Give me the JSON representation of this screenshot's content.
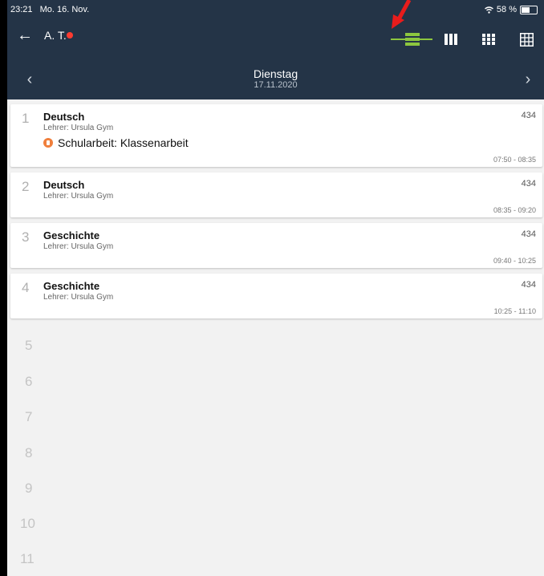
{
  "status": {
    "time": "23:21",
    "date": "Mo. 16. Nov.",
    "battery": "58 %",
    "battery_level": 0.58
  },
  "header": {
    "user": "A. T."
  },
  "date_nav": {
    "day": "Dienstag",
    "date": "17.11.2020"
  },
  "lessons": [
    {
      "num": "1",
      "subject": "Deutsch",
      "teacher": "Lehrer: Ursula Gym",
      "room": "434",
      "time": "07:50 - 08:35",
      "exam": "Schularbeit: Klassenarbeit"
    },
    {
      "num": "2",
      "subject": "Deutsch",
      "teacher": "Lehrer: Ursula Gym",
      "room": "434",
      "time": "08:35 - 09:20"
    },
    {
      "num": "3",
      "subject": "Geschichte",
      "teacher": "Lehrer: Ursula Gym",
      "room": "434",
      "time": "09:40 - 10:25"
    },
    {
      "num": "4",
      "subject": "Geschichte",
      "teacher": "Lehrer: Ursula Gym",
      "room": "434",
      "time": "10:25 - 11:10"
    }
  ],
  "empty_periods": [
    "5",
    "6",
    "7",
    "8",
    "9",
    "10",
    "11"
  ],
  "colors": {
    "header_bg": "#243447",
    "accent_green": "#8cc63f",
    "exam_orange": "#f07f3c",
    "notification_red": "#ff3b30",
    "annotation_arrow": "#e81c1c"
  }
}
